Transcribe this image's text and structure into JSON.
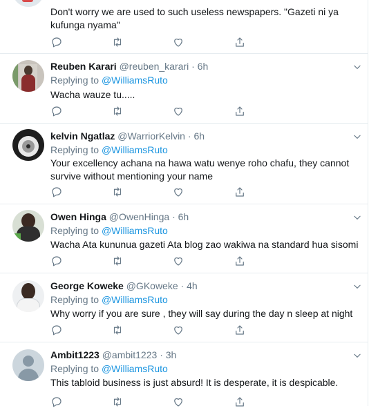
{
  "replying_label": "Replying to",
  "tweets": [
    {
      "name": "",
      "handle": "",
      "time": "",
      "mention": "",
      "text": "Don't worry we are used to such useless newspapers. \"Gazeti ni ya kufunga nyama\""
    },
    {
      "name": "Reuben Karari",
      "handle": "@reuben_karari",
      "time": "6h",
      "mention": "@WilliamsRuto",
      "text": "Wacha wauze tu....."
    },
    {
      "name": "kelvin Ngatlaz",
      "handle": "@WarriorKelvin",
      "time": "6h",
      "mention": "@WilliamsRuto",
      "text": "Your excellency achana na hawa watu wenye roho chafu, they cannot survive without mentioning your name"
    },
    {
      "name": "Owen Hinga",
      "handle": "@OwenHinga",
      "time": "6h",
      "mention": "@WilliamsRuto",
      "text": "Wacha Ata kununua gazeti Ata blog zao wakiwa na standard hua sisomi"
    },
    {
      "name": "George Koweke",
      "handle": "@GKoweke",
      "time": "4h",
      "mention": "@WilliamsRuto",
      "text": "Why worry if you are sure , they will say during the day n sleep at night"
    },
    {
      "name": "Ambit1223",
      "handle": "@ambit1223",
      "time": "3h",
      "mention": "@WilliamsRuto",
      "text": "This tabloid business is just absurd! It is desperate, it is despicable."
    }
  ],
  "colors": {
    "icon_gray": "#657786",
    "link_blue": "#1b95e0",
    "border": "#e6ecf0"
  },
  "icons": [
    "reply-icon",
    "retweet-icon",
    "like-icon",
    "share-icon",
    "chevron-down-icon",
    "default-avatar-icon"
  ]
}
